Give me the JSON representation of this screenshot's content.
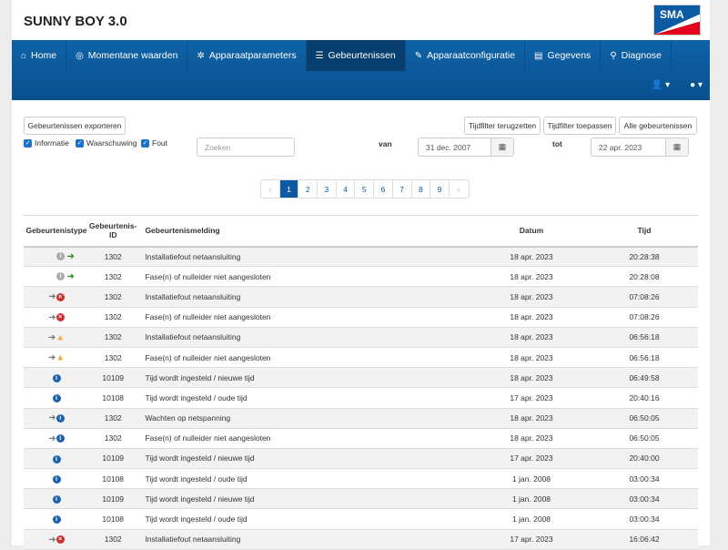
{
  "header": {
    "title": "SUNNY BOY 3.0",
    "logo_text": "SMA"
  },
  "nav": {
    "items": [
      {
        "label": "Home",
        "icon": "home-icon",
        "glyph": "⌂"
      },
      {
        "label": "Momentane waarden",
        "icon": "gauge-icon",
        "glyph": "◎"
      },
      {
        "label": "Apparaatparameters",
        "icon": "gear-icon",
        "glyph": "✲"
      },
      {
        "label": "Gebeurtenissen",
        "icon": "list-icon",
        "glyph": "☰",
        "active": true
      },
      {
        "label": "Apparaatconfiguratie",
        "icon": "wrench-icon",
        "glyph": "✎"
      },
      {
        "label": "Gegevens",
        "icon": "database-icon",
        "glyph": "▤"
      },
      {
        "label": "Diagnose",
        "icon": "search-icon",
        "glyph": "⚲"
      }
    ],
    "user_menu": "▾",
    "help_menu": "▾"
  },
  "toolbar": {
    "export": "Gebeurtenissen exporteren",
    "reset": "Tijdfilter terugzetten",
    "apply": "Tijdfilter toepassen",
    "all": "Alle gebeurtenissen"
  },
  "filters": {
    "info": "Informatie",
    "warning": "Waarschuwing",
    "error": "Fout",
    "search_placeholder": "Zoeken",
    "from_label": "van",
    "from": "31 dec. 2007",
    "to_label": "tot",
    "to": "22 apr. 2023"
  },
  "pagination": {
    "prev": "‹",
    "pages": [
      "1",
      "2",
      "3",
      "4",
      "5",
      "6",
      "7",
      "8",
      "9"
    ],
    "current": "1",
    "next": "›"
  },
  "table": {
    "headers": [
      "Gebeurtenistype",
      "Gebeurtenis-ID",
      "Gebeurtenismelding",
      "Datum",
      "Tijd"
    ],
    "rows": [
      {
        "type": "info-arrow",
        "id": "1302",
        "msg": "Installatiefout netaansluiting",
        "date": "18 apr. 2023",
        "time": "20:28:38"
      },
      {
        "type": "info-arrow",
        "id": "1302",
        "msg": "Fase(n) of nulleider niet aangesloten",
        "date": "18 apr. 2023",
        "time": "20:28:08"
      },
      {
        "type": "arrow-error",
        "id": "1302",
        "msg": "Installatiefout netaansluiting",
        "date": "18 apr. 2023",
        "time": "07:08:26"
      },
      {
        "type": "arrow-error",
        "id": "1302",
        "msg": "Fase(n) of nulleider niet aangesloten",
        "date": "18 apr. 2023",
        "time": "07:08:26"
      },
      {
        "type": "arrow-warning",
        "id": "1302",
        "msg": "Installatiefout netaansluiting",
        "date": "18 apr. 2023",
        "time": "06:56:18"
      },
      {
        "type": "arrow-warning",
        "id": "1302",
        "msg": "Fase(n) of nulleider niet aangesloten",
        "date": "18 apr. 2023",
        "time": "06:56:18"
      },
      {
        "type": "info",
        "id": "10109",
        "msg": "Tijd wordt ingesteld / nieuwe tijd",
        "date": "18 apr. 2023",
        "time": "06:49:58"
      },
      {
        "type": "info",
        "id": "10108",
        "msg": "Tijd wordt ingesteld / oude tijd",
        "date": "17 apr. 2023",
        "time": "20:40:16"
      },
      {
        "type": "arrow-info",
        "id": "1302",
        "msg": "Wachten op netspanning",
        "date": "18 apr. 2023",
        "time": "06:50:05"
      },
      {
        "type": "arrow-info",
        "id": "1302",
        "msg": "Fase(n) of nulleider niet aangesloten",
        "date": "18 apr. 2023",
        "time": "06:50:05"
      },
      {
        "type": "info",
        "id": "10109",
        "msg": "Tijd wordt ingesteld / nieuwe tijd",
        "date": "17 apr. 2023",
        "time": "20:40:00"
      },
      {
        "type": "info",
        "id": "10108",
        "msg": "Tijd wordt ingesteld / oude tijd",
        "date": "1 jan. 2008",
        "time": "03:00:34"
      },
      {
        "type": "info",
        "id": "10109",
        "msg": "Tijd wordt ingesteld / nieuwe tijd",
        "date": "1 jan. 2008",
        "time": "03:00:34"
      },
      {
        "type": "info",
        "id": "10108",
        "msg": "Tijd wordt ingesteld / oude tijd",
        "date": "1 jan. 2008",
        "time": "03:00:34"
      },
      {
        "type": "arrow-error",
        "id": "1302",
        "msg": "Installatiefout netaansluiting",
        "date": "17 apr. 2023",
        "time": "16:06:42"
      }
    ]
  }
}
